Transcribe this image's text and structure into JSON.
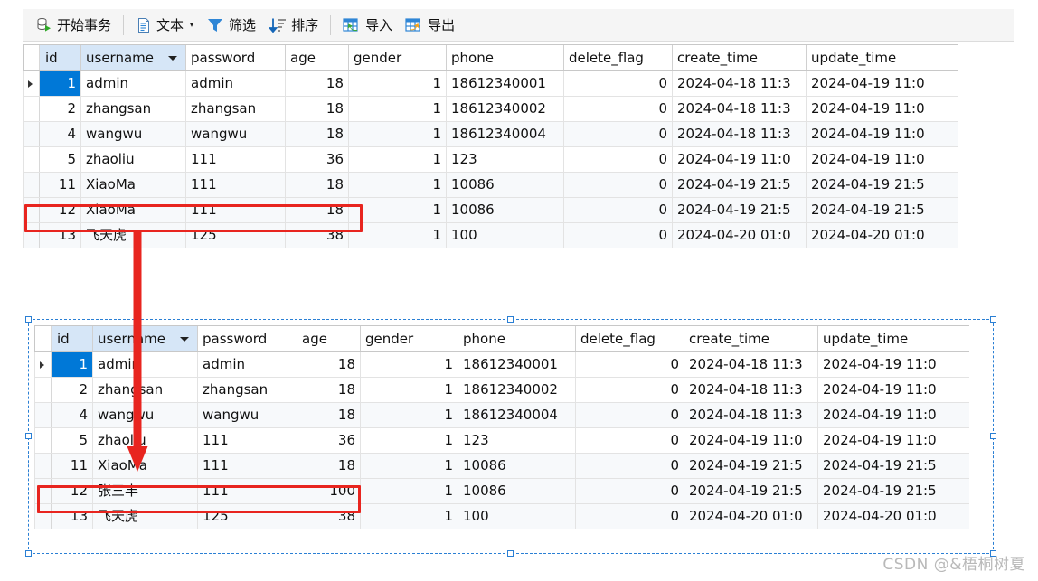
{
  "toolbar": {
    "items": [
      {
        "id": "start-transaction",
        "label": "开始事务",
        "icon": "database-play-icon",
        "caret": false
      },
      {
        "id": "text",
        "label": "文本",
        "icon": "document-text-icon",
        "caret": true
      },
      {
        "id": "filter",
        "label": "筛选",
        "icon": "funnel-icon",
        "caret": false
      },
      {
        "id": "sort",
        "label": "排序",
        "icon": "sort-descending-icon",
        "caret": false
      },
      {
        "id": "import",
        "label": "导入",
        "icon": "table-import-icon",
        "caret": false
      },
      {
        "id": "export",
        "label": "导出",
        "icon": "table-export-icon",
        "caret": false
      }
    ],
    "separators_after": [
      "start-transaction",
      "sort"
    ]
  },
  "columns": [
    {
      "key": "id",
      "label": "id",
      "align": "right",
      "cls": "c-id"
    },
    {
      "key": "username",
      "label": "username",
      "align": "left",
      "cls": "c-username"
    },
    {
      "key": "password",
      "label": "password",
      "align": "left",
      "cls": "c-password"
    },
    {
      "key": "age",
      "label": "age",
      "align": "right",
      "cls": "c-age"
    },
    {
      "key": "gender",
      "label": "gender",
      "align": "right",
      "cls": "c-gender"
    },
    {
      "key": "phone",
      "label": "phone",
      "align": "left",
      "cls": "c-phone"
    },
    {
      "key": "delete_flag",
      "label": "delete_flag",
      "align": "right",
      "cls": "c-delete"
    },
    {
      "key": "create_time",
      "label": "create_time",
      "align": "left",
      "cls": "c-create"
    },
    {
      "key": "update_time",
      "label": "update_time",
      "align": "left",
      "cls": "c-update"
    }
  ],
  "sorted_column": "username",
  "table_top": {
    "name": "query-result-grid-before",
    "selected_row_index": 0,
    "highlighted_row_index": 5,
    "rows": [
      {
        "id": "1",
        "username": "admin",
        "password": "admin",
        "age": "18",
        "gender": "1",
        "phone": "18612340001",
        "delete_flag": "0",
        "create_time": "2024-04-18 11:3",
        "update_time": "2024-04-19 11:0"
      },
      {
        "id": "2",
        "username": "zhangsan",
        "password": "zhangsan",
        "age": "18",
        "gender": "1",
        "phone": "18612340002",
        "delete_flag": "0",
        "create_time": "2024-04-18 11:3",
        "update_time": "2024-04-19 11:0"
      },
      {
        "id": "4",
        "username": "wangwu",
        "password": "wangwu",
        "age": "18",
        "gender": "1",
        "phone": "18612340004",
        "delete_flag": "0",
        "create_time": "2024-04-18 11:3",
        "update_time": "2024-04-19 11:0"
      },
      {
        "id": "5",
        "username": "zhaoliu",
        "password": "111",
        "age": "36",
        "gender": "1",
        "phone": "123",
        "delete_flag": "0",
        "create_time": "2024-04-19 11:0",
        "update_time": "2024-04-19 11:0"
      },
      {
        "id": "11",
        "username": "XiaoMa",
        "password": "111",
        "age": "18",
        "gender": "1",
        "phone": "10086",
        "delete_flag": "0",
        "create_time": "2024-04-19 21:5",
        "update_time": "2024-04-19 21:5"
      },
      {
        "id": "12",
        "username": "XiaoMa",
        "password": "111",
        "age": "18",
        "gender": "1",
        "phone": "10086",
        "delete_flag": "0",
        "create_time": "2024-04-19 21:5",
        "update_time": "2024-04-19 21:5"
      },
      {
        "id": "13",
        "username": "飞天虎",
        "password": "125",
        "age": "38",
        "gender": "1",
        "phone": "100",
        "delete_flag": "0",
        "create_time": "2024-04-20 01:0",
        "update_time": "2024-04-20 01:0"
      }
    ]
  },
  "table_bottom": {
    "name": "query-result-grid-after",
    "selected_row_index": 0,
    "highlighted_row_index": 5,
    "rows": [
      {
        "id": "1",
        "username": "admin",
        "password": "admin",
        "age": "18",
        "gender": "1",
        "phone": "18612340001",
        "delete_flag": "0",
        "create_time": "2024-04-18 11:3",
        "update_time": "2024-04-19 11:0"
      },
      {
        "id": "2",
        "username": "zhangsan",
        "password": "zhangsan",
        "age": "18",
        "gender": "1",
        "phone": "18612340002",
        "delete_flag": "0",
        "create_time": "2024-04-18 11:3",
        "update_time": "2024-04-19 11:0"
      },
      {
        "id": "4",
        "username": "wangwu",
        "password": "wangwu",
        "age": "18",
        "gender": "1",
        "phone": "18612340004",
        "delete_flag": "0",
        "create_time": "2024-04-18 11:3",
        "update_time": "2024-04-19 11:0"
      },
      {
        "id": "5",
        "username": "zhaoliu",
        "password": "111",
        "age": "36",
        "gender": "1",
        "phone": "123",
        "delete_flag": "0",
        "create_time": "2024-04-19 11:0",
        "update_time": "2024-04-19 11:0"
      },
      {
        "id": "11",
        "username": "XiaoMa",
        "password": "111",
        "age": "18",
        "gender": "1",
        "phone": "10086",
        "delete_flag": "0",
        "create_time": "2024-04-19 21:5",
        "update_time": "2024-04-19 21:5"
      },
      {
        "id": "12",
        "username": "张三丰",
        "password": "111",
        "age": "100",
        "gender": "1",
        "phone": "10086",
        "delete_flag": "0",
        "create_time": "2024-04-19 21:5",
        "update_time": "2024-04-19 21:5"
      },
      {
        "id": "13",
        "username": "飞天虎",
        "password": "125",
        "age": "38",
        "gender": "1",
        "phone": "100",
        "delete_flag": "0",
        "create_time": "2024-04-20 01:0",
        "update_time": "2024-04-20 01:0"
      }
    ]
  },
  "annotations": {
    "arrow_color": "#e8251f",
    "box_color": "#e8251f",
    "selection_color": "#2a7fd4"
  },
  "watermark": {
    "text": "CSDN @&梧桐树夏"
  }
}
